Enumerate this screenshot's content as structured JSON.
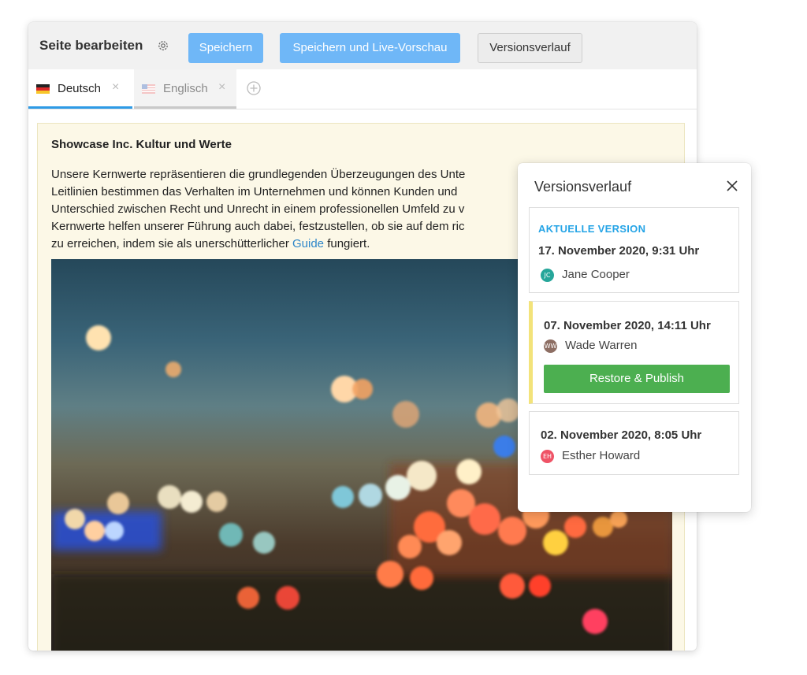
{
  "editor": {
    "title": "Seite bearbeiten",
    "buttons": {
      "save": "Speichern",
      "save_preview": "Speichern und Live-Vorschau",
      "history": "Versionsverlauf"
    },
    "tabs": [
      {
        "label": "Deutsch",
        "flag": "german-flag-icon",
        "active": true
      },
      {
        "label": "Englisch",
        "flag": "us-flag-icon",
        "active": false
      }
    ],
    "colors": {
      "accent": "#2e9be6",
      "button_blue": "#6fb7f7"
    }
  },
  "content": {
    "heading": "Showcase Inc. Kultur und Werte",
    "lines": [
      "Unsere Kernwerte repräsentieren die grundlegenden Überzeugungen des Unte",
      "Leitlinien bestimmen das Verhalten im Unternehmen und können Kunden und",
      "Unterschied zwischen Recht und Unrecht in einem professionellen Umfeld zu v",
      "Kernwerte helfen unserer Führung auch dabei, festzustellen, ob sie auf dem ric",
      "zu erreichen, indem sie als unerschütterlicher"
    ],
    "link": "Guide",
    "tail": "fungiert.",
    "image": "blurred-city-traffic-bokeh-photo"
  },
  "versions": {
    "title": "Versionsverlauf",
    "current_label": "AKTUELLE VERSION",
    "items": [
      {
        "date": "17. November 2020, 9:31 Uhr",
        "user": "Jane Cooper",
        "initials": "JC",
        "color": "#26a69a"
      },
      {
        "date": "07. November 2020, 14:11 Uhr",
        "user": "Wade Warren",
        "initials": "WW",
        "color": "#8d6e63"
      },
      {
        "date": "02. November 2020, 8:05 Uhr",
        "user": "Esther Howard",
        "initials": "EH",
        "color": "#ef5366"
      }
    ],
    "restore_label": "Restore & Publish",
    "highlight_color": "#f3e37a",
    "restore_color": "#4caf50"
  }
}
